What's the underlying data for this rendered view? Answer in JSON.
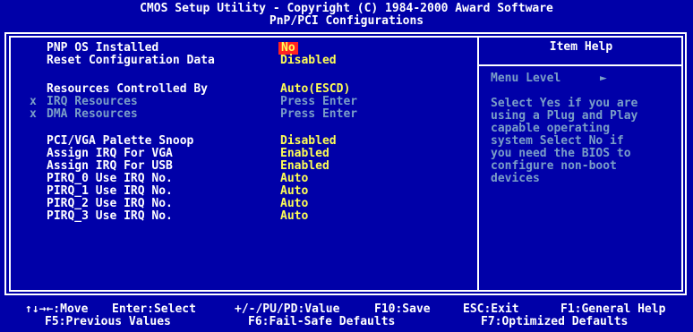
{
  "header": {
    "title": "CMOS Setup Utility - Copyright (C) 1984-2000 Award Software",
    "subtitle": "PnP/PCI Configurations"
  },
  "settings": [
    {
      "label": "PNP OS Installed",
      "value": "No",
      "selected": true
    },
    {
      "label": "Reset Configuration Data",
      "value": "Disabled"
    },
    {
      "label": "Resources Controlled By",
      "value": "Auto(ESCD)"
    },
    {
      "label": "IRQ Resources",
      "value": "Press Enter",
      "disabled": true,
      "marker": "x"
    },
    {
      "label": "DMA Resources",
      "value": "Press Enter",
      "disabled": true,
      "marker": "x"
    },
    {
      "label": "PCI/VGA Palette Snoop",
      "value": "Disabled"
    },
    {
      "label": "Assign IRQ For VGA",
      "value": "Enabled"
    },
    {
      "label": "Assign IRQ For USB",
      "value": "Enabled"
    },
    {
      "label": "PIRQ_0 Use IRQ No.",
      "value": "Auto"
    },
    {
      "label": "PIRQ_1 Use IRQ No.",
      "value": "Auto"
    },
    {
      "label": "PIRQ_2 Use IRQ No.",
      "value": "Auto"
    },
    {
      "label": "PIRQ_3 Use IRQ No.",
      "value": "Auto"
    }
  ],
  "help": {
    "title": "Item Help",
    "menu_level": "Menu Level",
    "menu_arrow": "►",
    "text": "Select Yes if you are\nusing a Plug and Play\ncapable operating\nsystem Select No if\nyou need the BIOS to\nconfigure non-boot\ndevices"
  },
  "footer": {
    "move": "↑↓→←:Move",
    "select": "Enter:Select",
    "value": "+/-/PU/PD:Value",
    "save": "F10:Save",
    "exit": "ESC:Exit",
    "general_help": "F1:General Help",
    "previous": "F5:Previous Values",
    "failsafe": "F6:Fail-Safe Defaults",
    "optimized": "F7:Optimized Defaults"
  },
  "colors": {
    "background": "#0000a8",
    "value": "#fefe54",
    "disabled": "#7a9ec7",
    "selected_bg": "#ff2222"
  }
}
